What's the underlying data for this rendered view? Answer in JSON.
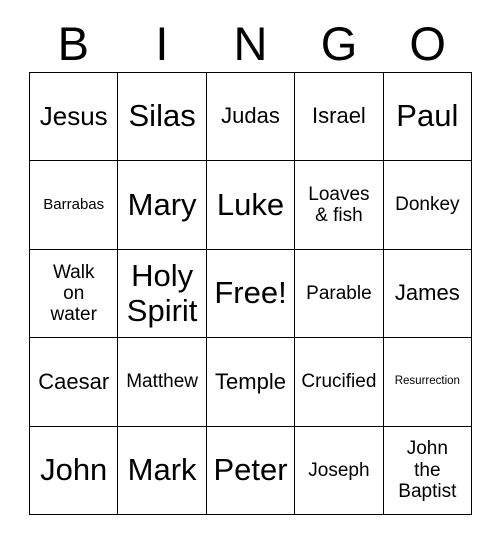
{
  "card": {
    "title_letters": [
      "B",
      "I",
      "N",
      "G",
      "O"
    ],
    "rows": [
      [
        {
          "text": "Jesus",
          "size": "fs-xl"
        },
        {
          "text": "Silas",
          "size": "fs-xxl"
        },
        {
          "text": "Judas",
          "size": "fs-l"
        },
        {
          "text": "Israel",
          "size": "fs-l"
        },
        {
          "text": "Paul",
          "size": "fs-xxl"
        }
      ],
      [
        {
          "text": "Barrabas",
          "size": "fs-s"
        },
        {
          "text": "Mary",
          "size": "fs-xxl"
        },
        {
          "text": "Luke",
          "size": "fs-xxl"
        },
        {
          "text": "Loaves\n& fish",
          "size": "fs-m"
        },
        {
          "text": "Donkey",
          "size": "fs-m"
        }
      ],
      [
        {
          "text": "Walk\non\nwater",
          "size": "fs-m"
        },
        {
          "text": "Holy\nSpirit",
          "size": "fs-xxl"
        },
        {
          "text": "Free!",
          "size": "fs-xxl"
        },
        {
          "text": "Parable",
          "size": "fs-m"
        },
        {
          "text": "James",
          "size": "fs-l"
        }
      ],
      [
        {
          "text": "Caesar",
          "size": "fs-l"
        },
        {
          "text": "Matthew",
          "size": "fs-m"
        },
        {
          "text": "Temple",
          "size": "fs-l"
        },
        {
          "text": "Crucified",
          "size": "fs-m"
        },
        {
          "text": "Resurrection",
          "size": "fs-xs"
        }
      ],
      [
        {
          "text": "John",
          "size": "fs-xxl"
        },
        {
          "text": "Mark",
          "size": "fs-xxl"
        },
        {
          "text": "Peter",
          "size": "fs-xxl"
        },
        {
          "text": "Joseph",
          "size": "fs-m"
        },
        {
          "text": "John\nthe\nBaptist",
          "size": "fs-m"
        }
      ]
    ],
    "colors": {
      "background": "#ffffff",
      "text": "#000000",
      "border": "#000000"
    }
  }
}
